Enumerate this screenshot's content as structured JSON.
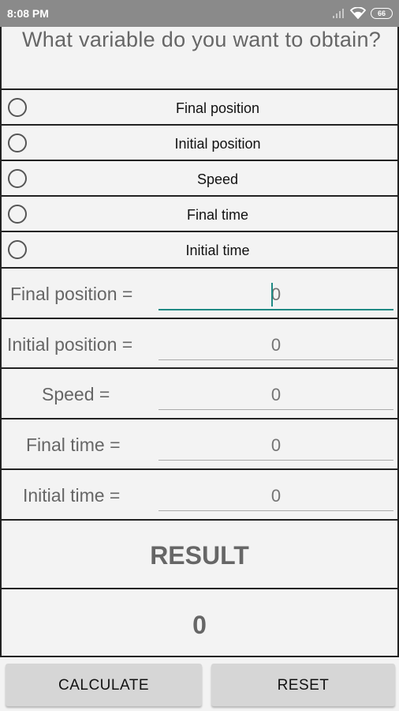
{
  "status_bar": {
    "time": "8:08 PM",
    "battery": "66",
    "icons": [
      "signal-icon",
      "wifi-icon",
      "battery-icon"
    ]
  },
  "question": "What variable do you want to obtain?",
  "options": [
    {
      "label": "Final position",
      "selected": false
    },
    {
      "label": "Initial position",
      "selected": false
    },
    {
      "label": "Speed",
      "selected": false
    },
    {
      "label": "Final time",
      "selected": false
    },
    {
      "label": "Initial time",
      "selected": false
    }
  ],
  "inputs": [
    {
      "label": "Final position =",
      "placeholder": "0",
      "focused": true
    },
    {
      "label": "Initial position =",
      "placeholder": "0",
      "focused": false
    },
    {
      "label": "Speed =",
      "placeholder": "0",
      "focused": false
    },
    {
      "label": "Final time =",
      "placeholder": "0",
      "focused": false
    },
    {
      "label": "Initial time =",
      "placeholder": "0",
      "focused": false
    }
  ],
  "result": {
    "title": "RESULT",
    "value": "0"
  },
  "buttons": {
    "calculate": "CALCULATE",
    "reset": "RESET"
  },
  "colors": {
    "accent": "#1f8a84",
    "background": "#f3f3f3",
    "status_bar": "#8a8a8a",
    "button": "#d6d6d6"
  }
}
